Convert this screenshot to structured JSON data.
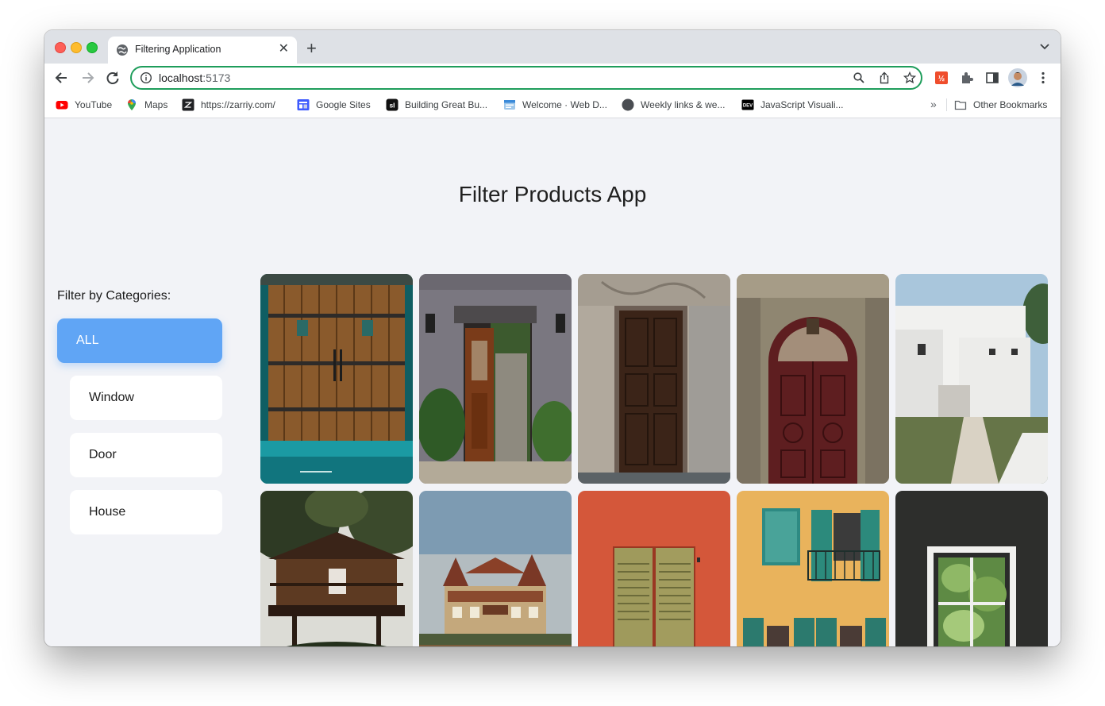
{
  "browser": {
    "tab_title": "Filtering Application",
    "url_host": "localhost",
    "url_port": ":5173",
    "omnibox_border_color": "#1e9d5b"
  },
  "bookmarks": [
    {
      "label": "YouTube",
      "icon": "youtube-icon"
    },
    {
      "label": "Maps",
      "icon": "maps-icon"
    },
    {
      "label": "https://zarriy.com/",
      "icon": "zarriy-icon"
    },
    {
      "label": "Google Sites",
      "icon": "google-sites-icon"
    },
    {
      "label": "Building Great Bu...",
      "icon": "si-icon"
    },
    {
      "label": "Welcome · Web D...",
      "icon": "web-icon"
    },
    {
      "label": "Weekly links & we...",
      "icon": "circle-icon"
    },
    {
      "label": "JavaScript Visuali...",
      "icon": "dev-icon"
    }
  ],
  "other_bookmarks": "Other Bookmarks",
  "app": {
    "title": "Filter Products App",
    "filter_label": "Filter by Categories:",
    "categories": [
      "ALL",
      "Window",
      "Door",
      "House"
    ],
    "active_category": "ALL",
    "accent_color": "#60a5f5"
  },
  "products": [
    {
      "image": "teal-wooden-double-door"
    },
    {
      "image": "open-wooden-door-with-plants"
    },
    {
      "image": "carved-dark-wooden-door"
    },
    {
      "image": "ornate-arched-red-door"
    },
    {
      "image": "white-modern-house"
    },
    {
      "image": "wooden-treehouse"
    },
    {
      "image": "victorian-house-on-hill"
    },
    {
      "image": "green-shutters-on-orange-wall"
    },
    {
      "image": "yellow-building-teal-shutters"
    },
    {
      "image": "window-in-dark-wall"
    }
  ]
}
